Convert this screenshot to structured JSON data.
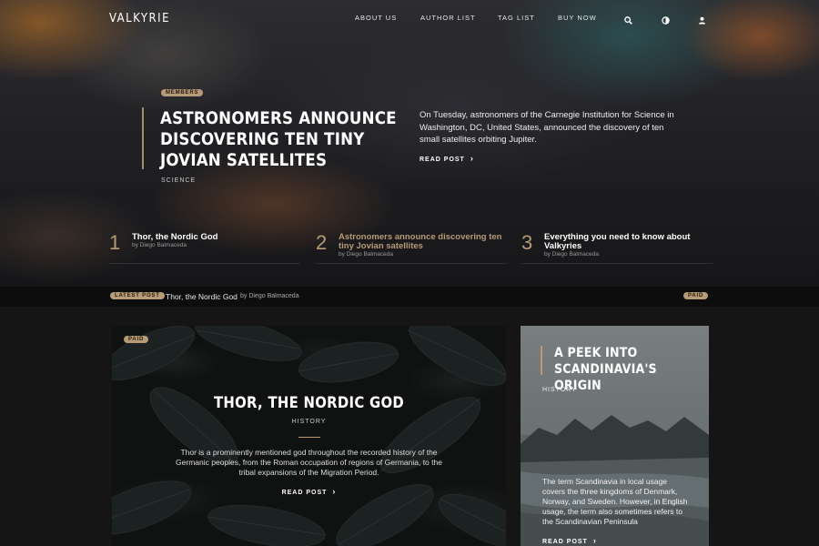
{
  "brand": "VALKYRIE",
  "nav": {
    "items": [
      "ABOUT US",
      "AUTHOR LIST",
      "TAG LIST",
      "BUY NOW"
    ],
    "icons": [
      "search-icon",
      "theme-toggle-icon",
      "user-icon"
    ]
  },
  "featured": {
    "badge": "MEMBERS",
    "title": "ASTRONOMERS ANNOUNCE DISCOVERING TEN TINY JOVIAN SATELLITES",
    "tag": "SCIENCE",
    "description": "On Tuesday, astronomers of the Carnegie Institution for Science in Washington, DC, United States, announced the discovery of ten small satellites orbiting Jupiter.",
    "read_label": "READ POST"
  },
  "trending": [
    {
      "num": "1",
      "title": "Thor, the Nordic God",
      "byline": "by Diego Balmaceda"
    },
    {
      "num": "2",
      "title": "Astronomers announce discovering ten tiny Jovian satellites",
      "byline": "by Diego Balmaceda"
    },
    {
      "num": "3",
      "title": "Everything you need to know about Valkyries",
      "byline": "by Diego Balmaceda"
    }
  ],
  "latest": {
    "badge": "LATEST POST",
    "title": "Thor, the Nordic God",
    "byline": "by Diego Balmaceda",
    "paid_badge": "PAID"
  },
  "cards": [
    {
      "badge": "PAID",
      "title": "THOR, THE NORDIC GOD",
      "tag": "HISTORY",
      "description": "Thor is a prominently mentioned god throughout the recorded history of the Germanic peoples, from the Roman occupation of regions of Germania, to the tribal expansions of the Migration Period.",
      "read_label": "READ POST"
    },
    {
      "title": "A PEEK INTO SCANDINAVIA'S ORIGIN",
      "tag": "HISTORY",
      "description": "The term Scandinavia in local usage covers the three kingdoms of Denmark, Norway, and Sweden. However, in English usage, the term also sometimes refers to the Scandinavian Peninsula",
      "read_label": "READ POST"
    }
  ],
  "colors": {
    "accent": "#b79a76",
    "background": "#151515"
  }
}
